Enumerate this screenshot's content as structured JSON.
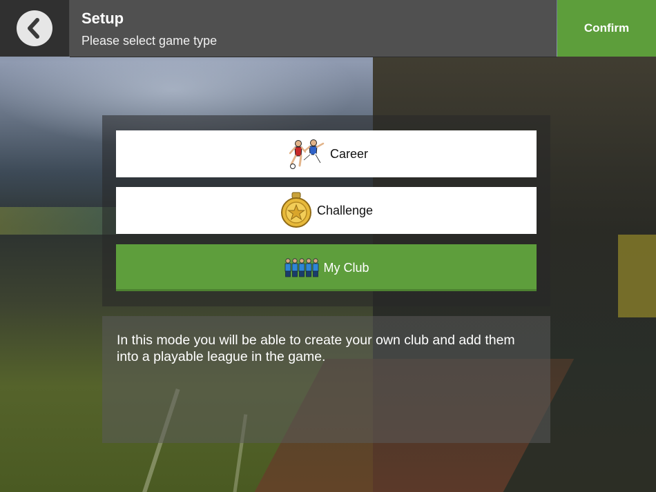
{
  "header": {
    "title": "Setup",
    "subtitle": "Please select game type",
    "confirm_label": "Confirm"
  },
  "options": [
    {
      "label": "Career",
      "icon": "football-players-icon"
    },
    {
      "label": "Challenge",
      "icon": "gold-medal-icon"
    },
    {
      "label": "My Club",
      "icon": "team-squad-icon",
      "selected": true
    }
  ],
  "description": "In this mode you will be able to create your own club and add them into a playable league in the game.",
  "colors": {
    "accent_green": "#5e9e3c",
    "header_dark": "#303030",
    "header_mid": "#505050"
  }
}
